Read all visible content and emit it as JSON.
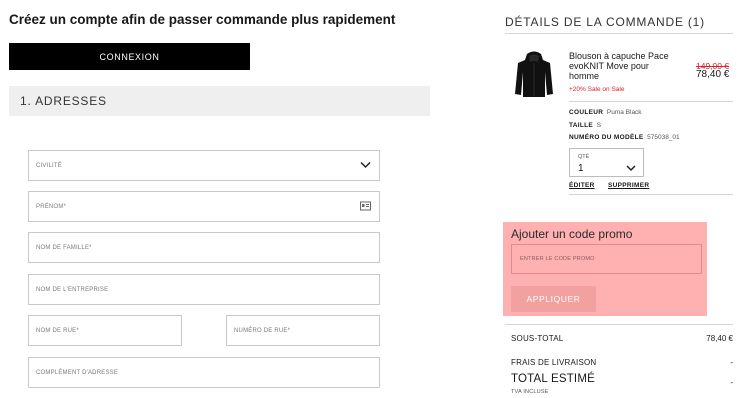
{
  "page_title": "Créez un compte afin de passer commande plus rapidement",
  "login_button": "CONNEXION",
  "addresses_section": "1. ADRESSES",
  "form": {
    "civility_placeholder": "CIVILITÉ",
    "first_name_placeholder": "PRÉNOM*",
    "last_name_placeholder": "NOM DE FAMILLE*",
    "company_placeholder": "NOM DE L'ENTREPRISE",
    "street_name_placeholder": "NOM DE RUE*",
    "street_number_placeholder": "NUMÉRO DE RUE*",
    "address_complement_placeholder": "COMPLÉMENT D'ADRESSE"
  },
  "order": {
    "heading": "DÉTAILS DE LA COMMANDE (1)",
    "product": {
      "name": "Blouson à capuche Pace evoKNIT Move pour homme",
      "sale_tag": "+20% Sale on Sale",
      "old_price": "149,00 €",
      "price": "78,40 €",
      "color_label": "COULEUR",
      "color_value": "Puma Black",
      "size_label": "TAILLE",
      "size_value": "S",
      "model_label": "NUMÉRO DU MODÈLE",
      "model_value": "575038_01",
      "qty_label": "QTÉ",
      "qty_value": "1",
      "edit_link": "ÉDITER",
      "remove_link": "SUPPRIMER"
    },
    "promo": {
      "title": "Ajouter un code promo",
      "input_placeholder": "ENTRER LE CODE PROMO",
      "apply_button": "APPLIQUER",
      "highlight_color": "#ffb0b0"
    },
    "summary": {
      "subtotal_label": "SOUS-TOTAL",
      "subtotal_value": "78,40 €",
      "shipping_label": "FRAIS DE LIVRAISON",
      "shipping_value": "-",
      "total_label": "TOTAL ESTIMÉ",
      "total_value": "-",
      "tax_note": "TVA INCLUSE"
    }
  },
  "icons": {
    "civility_dropdown": "chevron-down-icon",
    "first_name_field": "contact-card-icon",
    "qty_dropdown": "chevron-down-icon",
    "product_image": "black-hooded-jacket"
  },
  "colors": {
    "primary_button": "#000000",
    "sale_red": "#d8232a",
    "section_bg": "#efefef"
  }
}
